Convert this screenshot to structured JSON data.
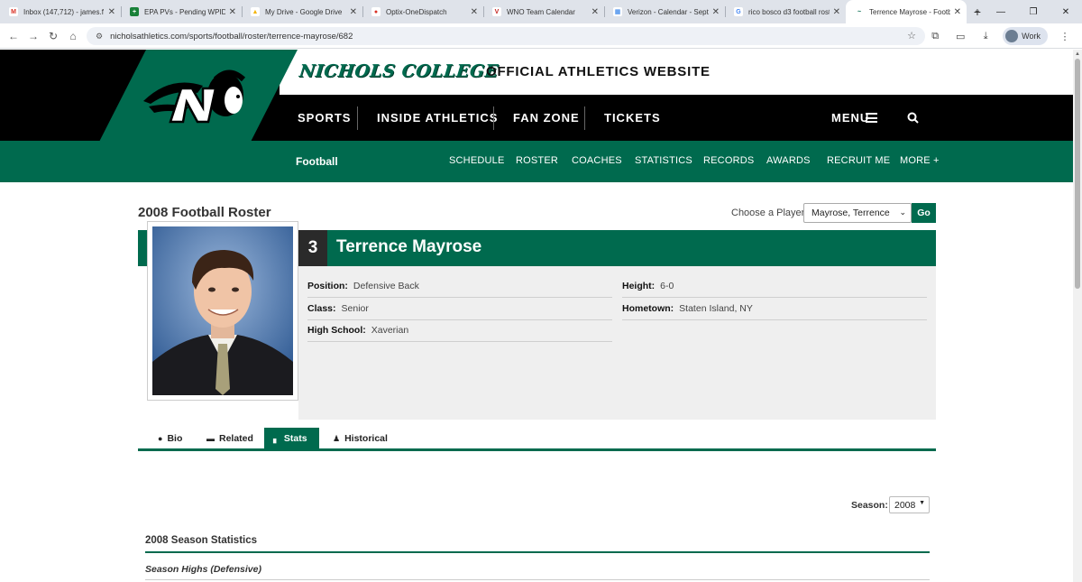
{
  "browser": {
    "tabs": [
      {
        "title": "Inbox (147,712) - james.f",
        "fav_color": "#d93025",
        "fav_glyph": "M",
        "active": false
      },
      {
        "title": "EPA PVs - Pending WPID S",
        "fav_color": "#188038",
        "fav_glyph": "+",
        "active": false
      },
      {
        "title": "My Drive - Google Drive",
        "fav_color": "#f4b400",
        "fav_glyph": "▲",
        "active": false
      },
      {
        "title": "Optix-OneDispatch",
        "fav_color": "#d93025",
        "fav_glyph": "●",
        "active": false
      },
      {
        "title": "WNO Team Calendar",
        "fav_color": "#c5221f",
        "fav_glyph": "V",
        "active": false
      },
      {
        "title": "Verizon - Calendar - Septe",
        "fav_color": "#1a73e8",
        "fav_glyph": "▦",
        "active": false
      },
      {
        "title": "rico bosco d3 football rost",
        "fav_color": "#ffffff",
        "fav_glyph": "G",
        "active": false
      },
      {
        "title": "Terrence Mayrose - Footb",
        "fav_color": "#006a4e",
        "fav_glyph": "~",
        "active": true
      }
    ],
    "new_tab": "+",
    "url": "nicholsathletics.com/sports/football/roster/terrence-mayrose/682",
    "profile_label": "Work"
  },
  "site": {
    "wordmark": "NICHOLS COLLEGE",
    "tagline": "OFFICIAL ATHLETICS WEBSITE",
    "main_nav": [
      "SPORTS",
      "INSIDE ATHLETICS",
      "FAN ZONE",
      "TICKETS"
    ],
    "menu_label": "MENU",
    "sport": "Football",
    "sub_nav": [
      "SCHEDULE",
      "ROSTER",
      "COACHES",
      "STATISTICS",
      "RECORDS",
      "AWARDS",
      "RECRUIT ME",
      "MORE +"
    ],
    "brand_color": "#006a4e"
  },
  "roster": {
    "title": "2008 Football Roster",
    "choose_label": "Choose a Player:",
    "selected_player": "Mayrose, Terrence",
    "go_label": "Go"
  },
  "player": {
    "number": "3",
    "name": "Terrence Mayrose",
    "facts_left": [
      {
        "label": "Position:",
        "value": "Defensive Back"
      },
      {
        "label": "Class:",
        "value": "Senior"
      },
      {
        "label": "High School:",
        "value": "Xaverian"
      }
    ],
    "facts_right": [
      {
        "label": "Height:",
        "value": "6-0"
      },
      {
        "label": "Hometown:",
        "value": "Staten Island, NY"
      }
    ]
  },
  "profile_tabs": [
    {
      "label": "Bio",
      "icon": "comment-icon",
      "active": false
    },
    {
      "label": "Related",
      "icon": "newspaper-icon",
      "active": false
    },
    {
      "label": "Stats",
      "icon": "bar-chart-icon",
      "active": true
    },
    {
      "label": "Historical",
      "icon": "person-icon",
      "active": false
    }
  ],
  "stats": {
    "season_label": "Season:",
    "season_value": "2008",
    "section_title": "2008 Season Statistics",
    "subsection": "Season Highs (Defensive)"
  }
}
